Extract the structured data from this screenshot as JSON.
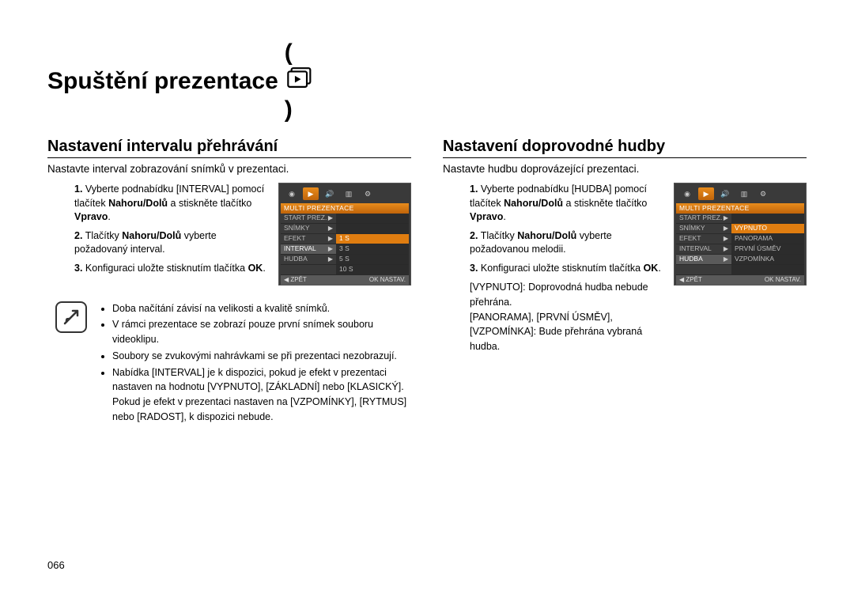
{
  "page": {
    "number": "066",
    "title": "Spuštění prezentace"
  },
  "left": {
    "heading": "Nastavení intervalu přehrávání",
    "intro": "Nastavte interval zobrazování snímků v prezentaci.",
    "steps": [
      "Vyberte podnabídku [INTERVAL] pomocí tlačítek <b>Nahoru/Dolů</b> a stiskněte tlačítko <b>Vpravo</b>.",
      "Tlačítky <b>Nahoru/Dolů</b> vyberte požadovaný interval.",
      "Konfiguraci uložte stisknutím tlačítka <b>OK</b>."
    ],
    "menu": {
      "title": "MULTI PREZENTACE",
      "left": [
        "START PREZ.",
        "SNÍMKY",
        "EFEKT",
        "INTERVAL",
        "HUDBA"
      ],
      "right": [
        "",
        "",
        "1 S",
        "3 S",
        "5 S",
        "10 S"
      ],
      "active_left": "INTERVAL",
      "active_right": "1 S",
      "back": "ZPĚT",
      "ok": "OK",
      "set": "NASTAV."
    },
    "notes": [
      "Doba načítání závisí na velikosti a kvalitě snímků.",
      "V rámci prezentace se zobrazí pouze první snímek souboru videoklipu.",
      "Soubory se zvukovými nahrávkami se při prezentaci nezobrazují.",
      "Nabídka [INTERVAL] je k dispozici, pokud je efekt v prezentaci nastaven na hodnotu [VYPNUTO], [ZÁKLADNÍ] nebo [KLASICKÝ]. Pokud je efekt v prezentaci nastaven na [VZPOMÍNKY], [RYTMUS] nebo [RADOST], k dispozici nebude."
    ]
  },
  "right": {
    "heading": "Nastavení doprovodné hudby",
    "intro": "Nastavte hudbu doprovázející prezentaci.",
    "steps": [
      "Vyberte podnabídku [HUDBA] pomocí tlačítek <b>Nahoru/Dolů</b> a stiskněte tlačítko <b>Vpravo</b>.",
      "Tlačítky <b>Nahoru/Dolů</b> vyberte požadovanou melodii.",
      "Konfiguraci uložte stisknutím tlačítka <b>OK</b>."
    ],
    "extra": [
      "[VYPNUTO]: Doprovodná hudba nebude přehrána.",
      "[PANORAMA], [PRVNÍ ÚSMĚV], [VZPOMÍNKA]: Bude přehrána vybraná hudba."
    ],
    "menu": {
      "title": "MULTI PREZENTACE",
      "left": [
        "START PREZ.",
        "SNÍMKY",
        "EFEKT",
        "INTERVAL",
        "HUDBA"
      ],
      "right": [
        "",
        "VYPNUTO",
        "PANORAMA",
        "PRVNÍ ÚSMĚV",
        "VZPOMÍNKA"
      ],
      "active_left": "HUDBA",
      "active_right": "VYPNUTO",
      "back": "ZPĚT",
      "ok": "OK",
      "set": "NASTAV."
    }
  }
}
